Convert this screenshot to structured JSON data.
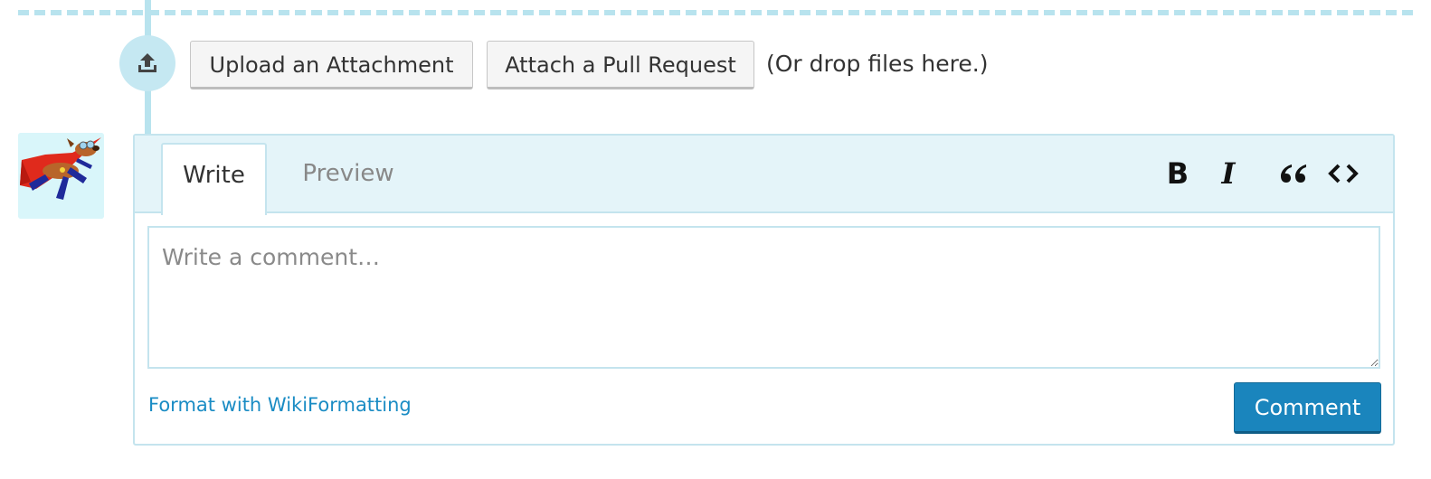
{
  "upload_bar": {
    "icon": "upload-icon",
    "upload_label": "Upload an Attachment",
    "pull_request_label": "Attach a Pull Request",
    "drop_hint": "(Or drop files here.)"
  },
  "author": {
    "avatar": "superhero-dog-avatar"
  },
  "editor": {
    "tabs": [
      {
        "label": "Write",
        "active": true
      },
      {
        "label": "Preview",
        "active": false
      }
    ],
    "toolbar": {
      "bold": "B",
      "italic": "I",
      "quote": "quote-icon",
      "code": "code-icon"
    },
    "textarea_value": "",
    "textarea_placeholder": "Write a comment…",
    "format_link": "Format with WikiFormatting",
    "submit_label": "Comment"
  },
  "colors": {
    "accent": "#1a85bd",
    "link": "#1a8cc4",
    "border": "#c4e4ee",
    "timeline": "#b8e3ee"
  }
}
